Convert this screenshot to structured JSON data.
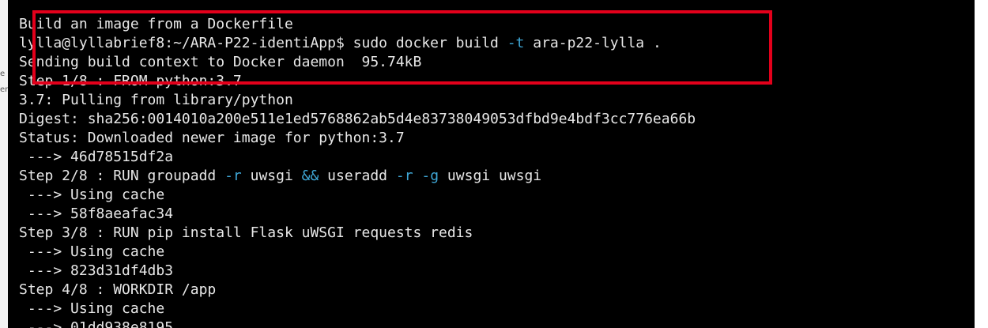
{
  "sidebar_fragments": [
    "e",
    "er"
  ],
  "terminal": {
    "lines": [
      {
        "parts": [
          {
            "t": "Build an image from a Dockerfile"
          }
        ]
      },
      {
        "parts": [
          {
            "t": "lylla@lyllabrief8:~/ARA-P22-identiApp$ sudo docker build "
          },
          {
            "t": "-t",
            "c": "flag"
          },
          {
            "t": " ara-p22-lylla ."
          }
        ]
      },
      {
        "parts": [
          {
            "t": "Sending build context to Docker daemon  95.74kB"
          }
        ]
      },
      {
        "parts": [
          {
            "t": "Step 1/8 : FROM python:3.7"
          }
        ]
      },
      {
        "parts": [
          {
            "t": "3.7: Pulling from library/python"
          }
        ]
      },
      {
        "parts": [
          {
            "t": "Digest: sha256:0014010a200e511e1ed5768862ab5d4e83738049053dfbd9e4bdf3cc776ea66b"
          }
        ]
      },
      {
        "parts": [
          {
            "t": "Status: Downloaded newer image for python:3.7"
          }
        ]
      },
      {
        "parts": [
          {
            "t": " ---> 46d78515df2a"
          }
        ]
      },
      {
        "parts": [
          {
            "t": "Step 2/8 : RUN groupadd "
          },
          {
            "t": "-r",
            "c": "flag"
          },
          {
            "t": " uwsgi "
          },
          {
            "t": "&&",
            "c": "op"
          },
          {
            "t": " useradd "
          },
          {
            "t": "-r",
            "c": "flag"
          },
          {
            "t": " "
          },
          {
            "t": "-g",
            "c": "flag"
          },
          {
            "t": " uwsgi uwsgi"
          }
        ]
      },
      {
        "parts": [
          {
            "t": " ---> Using cache"
          }
        ]
      },
      {
        "parts": [
          {
            "t": " ---> 58f8aeafac34"
          }
        ]
      },
      {
        "parts": [
          {
            "t": "Step 3/8 : RUN pip install Flask uWSGI requests redis"
          }
        ]
      },
      {
        "parts": [
          {
            "t": " ---> Using cache"
          }
        ]
      },
      {
        "parts": [
          {
            "t": " ---> 823d31df4db3"
          }
        ]
      },
      {
        "parts": [
          {
            "t": "Step 4/8 : WORKDIR /app"
          }
        ]
      },
      {
        "parts": [
          {
            "t": " ---> Using cache"
          }
        ]
      },
      {
        "parts": [
          {
            "t": " ---> 01dd938e8195"
          }
        ]
      }
    ]
  },
  "colors": {
    "background": "#000000",
    "text": "#e8e8e8",
    "flag": "#3fa7d6",
    "highlight_border": "#e3001b"
  }
}
